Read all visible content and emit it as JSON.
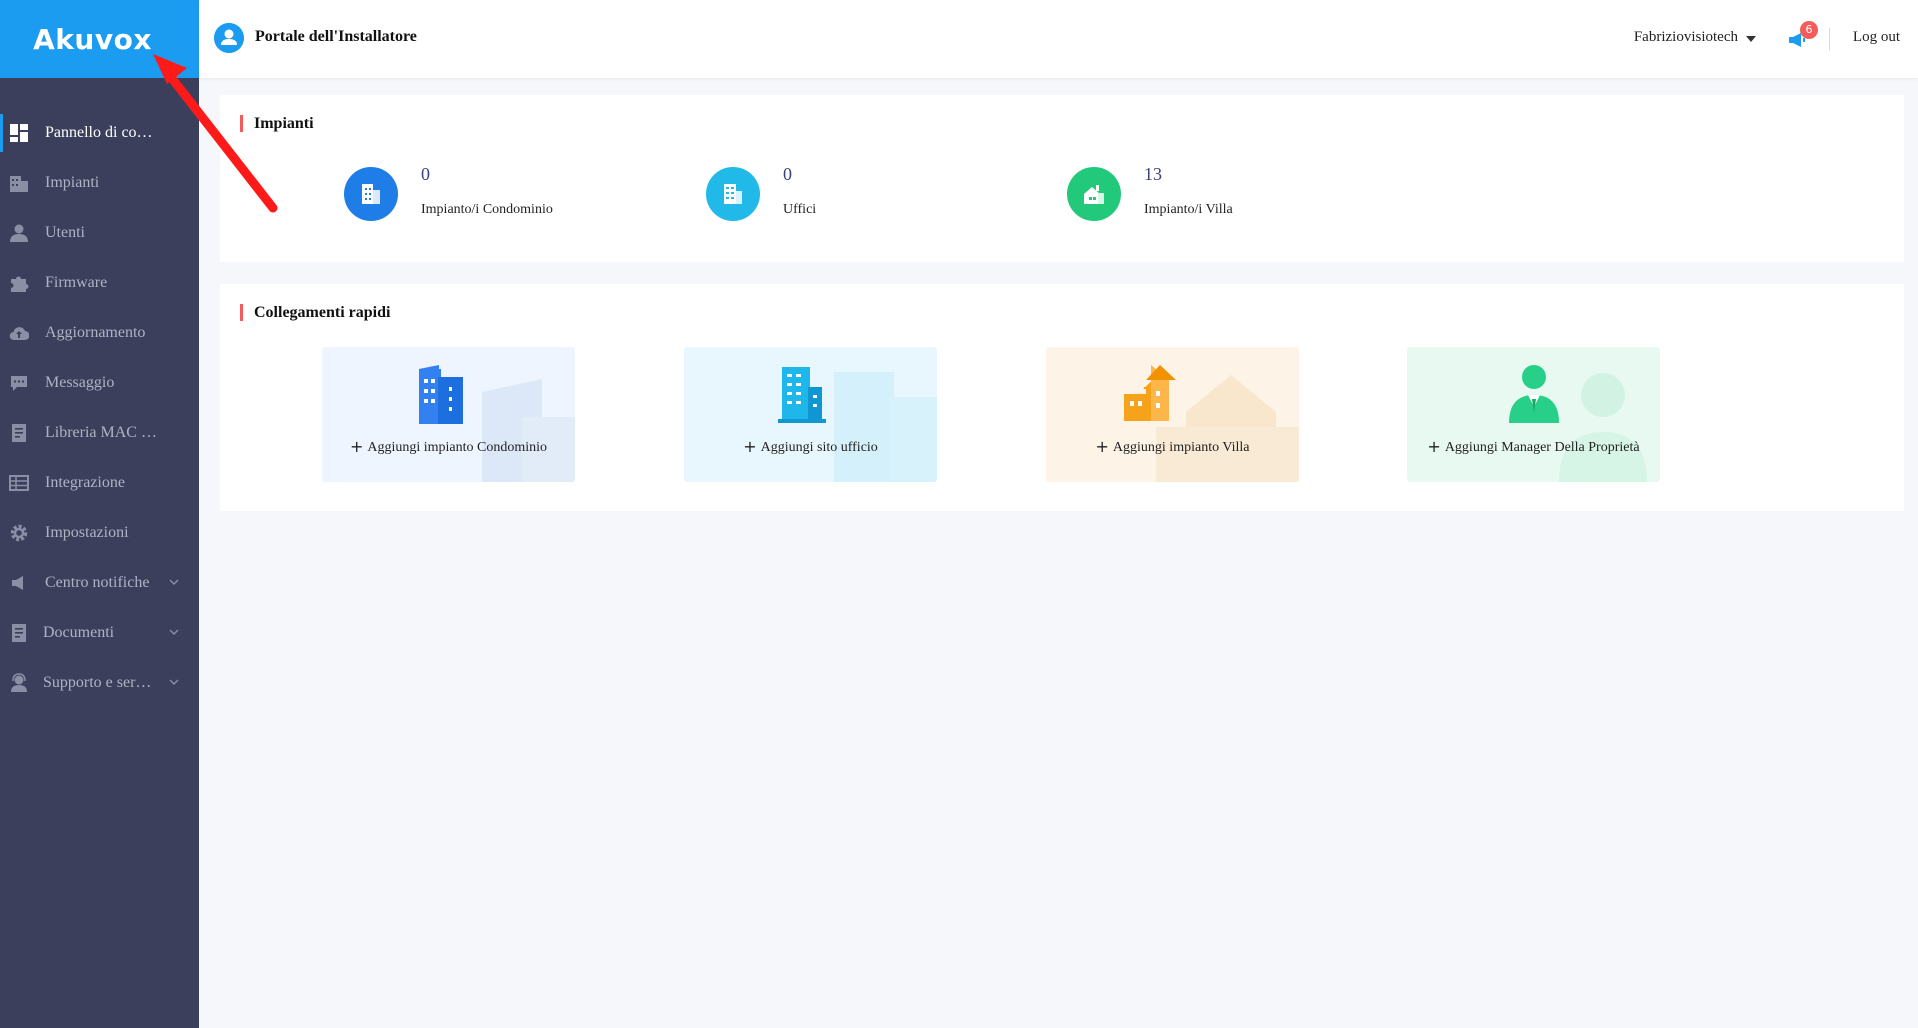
{
  "app": {
    "logo": "Akuvox",
    "portal_title": "Portale dell'Installatore"
  },
  "header": {
    "user": "Fabriziovisiotech",
    "notification_count": "6",
    "logout": "Log out"
  },
  "sidebar": {
    "items": [
      {
        "label": "Pannello di co…",
        "icon": "dashboard-icon",
        "active": true
      },
      {
        "label": "Impianti",
        "icon": "buildings-icon"
      },
      {
        "label": "Utenti",
        "icon": "user-icon"
      },
      {
        "label": "Firmware",
        "icon": "puzzle-icon"
      },
      {
        "label": "Aggiornamento",
        "icon": "cloud-upload-icon"
      },
      {
        "label": "Messaggio",
        "icon": "chat-icon"
      },
      {
        "label": "Libreria MAC …",
        "icon": "document-icon"
      },
      {
        "label": "Integrazione",
        "icon": "table-icon"
      },
      {
        "label": "Impostazioni",
        "icon": "gear-icon"
      },
      {
        "label": "Centro notifiche",
        "icon": "megaphone-icon",
        "expandable": true
      },
      {
        "label": "Documenti",
        "icon": "document-icon",
        "expandable": true
      },
      {
        "label": "Supporto e ser…",
        "icon": "headset-icon",
        "expandable": true
      }
    ]
  },
  "impianti": {
    "title": "Impianti",
    "stats": [
      {
        "value": "0",
        "label": "Impianto/i Condominio",
        "color": "#1f7de8"
      },
      {
        "value": "0",
        "label": "Uffici",
        "color": "#21b9e8"
      },
      {
        "value": "13",
        "label": "Impianto/i Villa",
        "color": "#22c97a"
      }
    ]
  },
  "quick_links": {
    "title": "Collegamenti rapidi",
    "items": [
      {
        "label": "Aggiungi impianto Condominio",
        "bg": "#eef5fe"
      },
      {
        "label": "Aggiungi sito ufficio",
        "bg": "#e8f7fd"
      },
      {
        "label": "Aggiungi impianto Villa",
        "bg": "#fdf3e6"
      },
      {
        "label": "Aggiungi Manager Della Proprietà",
        "bg": "#e8f9f1"
      }
    ]
  }
}
